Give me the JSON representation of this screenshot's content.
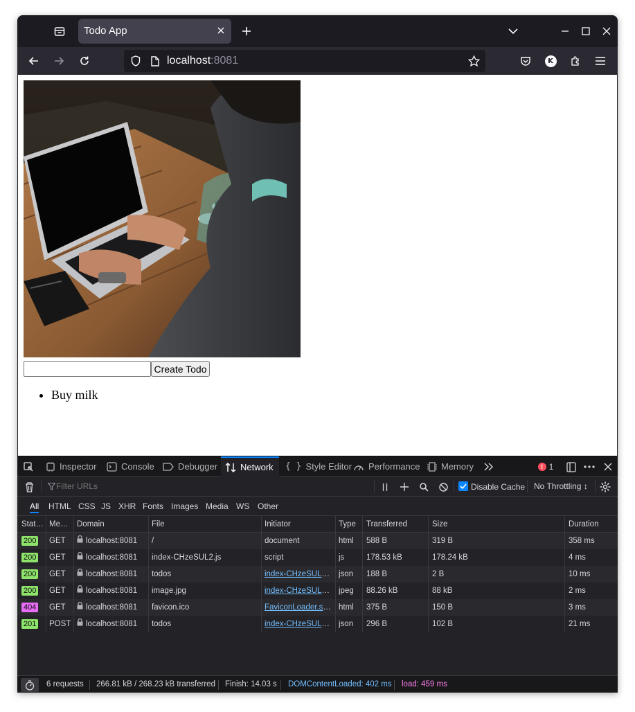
{
  "browser": {
    "tab_title": "Todo App",
    "url_host": "localhost",
    "url_port": ":8081",
    "account_initial": "K"
  },
  "page": {
    "input_value": "",
    "create_button": "Create Todo",
    "todos": [
      "Buy milk"
    ]
  },
  "devtools": {
    "tabs": [
      "Inspector",
      "Console",
      "Debugger",
      "Network",
      "Style Editor",
      "Performance",
      "Memory"
    ],
    "active_tab": "Network",
    "error_count": "1",
    "filter_placeholder": "Filter URLs",
    "disable_cache_label": "Disable Cache",
    "disable_cache_checked": true,
    "throttling": "No Throttling ↕",
    "type_filters": [
      "All",
      "HTML",
      "CSS",
      "JS",
      "XHR",
      "Fonts",
      "Images",
      "Media",
      "WS",
      "Other"
    ],
    "active_type_filter": "All",
    "columns": [
      "Stat…",
      "Me…",
      "Domain",
      "File",
      "Initiator",
      "Type",
      "Transferred",
      "Size",
      "Duration"
    ],
    "requests": [
      {
        "status": "200",
        "method": "GET",
        "domain": "localhost:8081",
        "file": "/",
        "initiator": "document",
        "initiator_link": false,
        "type": "html",
        "transferred": "588 B",
        "size": "319 B",
        "duration": "358 ms"
      },
      {
        "status": "200",
        "method": "GET",
        "domain": "localhost:8081",
        "file": "index-CHzeSUL2.js",
        "initiator": "script",
        "initiator_link": false,
        "type": "js",
        "transferred": "178.53 kB",
        "size": "178.24 kB",
        "duration": "4 ms"
      },
      {
        "status": "200",
        "method": "GET",
        "domain": "localhost:8081",
        "file": "todos",
        "initiator": "index-CHzeSUL2.…",
        "initiator_link": true,
        "type": "json",
        "transferred": "188 B",
        "size": "2 B",
        "duration": "10 ms"
      },
      {
        "status": "200",
        "method": "GET",
        "domain": "localhost:8081",
        "file": "image.jpg",
        "initiator": "index-CHzeSUL2.…",
        "initiator_link": true,
        "type": "jpeg",
        "transferred": "88.26 kB",
        "size": "88 kB",
        "duration": "2 ms"
      },
      {
        "status": "404",
        "method": "GET",
        "domain": "localhost:8081",
        "file": "favicon.ico",
        "initiator": "FaviconLoader.sy…",
        "initiator_link": true,
        "type": "html",
        "transferred": "375 B",
        "size": "150 B",
        "duration": "3 ms"
      },
      {
        "status": "201",
        "method": "POST",
        "domain": "localhost:8081",
        "file": "todos",
        "initiator": "index-CHzeSUL2.…",
        "initiator_link": true,
        "type": "json",
        "transferred": "296 B",
        "size": "102 B",
        "duration": "21 ms"
      }
    ],
    "status_bar": {
      "requests": "6 requests",
      "transferred": "266.81 kB / 268.23 kB transferred",
      "finish": "Finish: 14.03 s",
      "dom_content_loaded": "DOMContentLoaded: 402 ms",
      "load": "load: 459 ms"
    }
  },
  "colors": {
    "status_2xx": "#8ee36a",
    "status_4xx": "#e96cf6",
    "dom_content_loaded": "#75bfff",
    "load": "#ff7de9",
    "accent": "#0a84ff",
    "error": "#ff4f5e"
  }
}
